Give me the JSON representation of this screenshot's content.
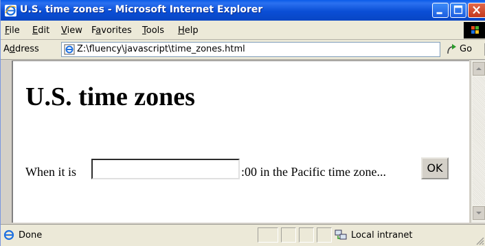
{
  "window": {
    "title": "U.S. time zones - Microsoft Internet Explorer"
  },
  "menu": {
    "items": [
      {
        "accel": "F",
        "rest": "ile"
      },
      {
        "accel": "E",
        "rest": "dit"
      },
      {
        "accel": "V",
        "rest": "iew"
      },
      {
        "pre": "F",
        "accel": "a",
        "rest": "vorites"
      },
      {
        "accel": "T",
        "rest": "ools"
      },
      {
        "accel": "H",
        "rest": "elp"
      }
    ]
  },
  "address": {
    "label_pre": "A",
    "label_accel": "d",
    "label_rest": "dress",
    "url": "Z:\\fluency\\javascript\\time_zones.html",
    "go_label": "Go"
  },
  "page": {
    "title": "U.S. time zones",
    "sentence_pre": "When it is",
    "input_value": "",
    "sentence_post": ":00 in the Pacific time zone...",
    "ok_label": "OK"
  },
  "status": {
    "text": "Done",
    "zone": "Local intranet"
  },
  "colors": {
    "titlebar": "#0a4ed6",
    "chrome": "#ece9d8",
    "close_button": "#c2381d"
  }
}
